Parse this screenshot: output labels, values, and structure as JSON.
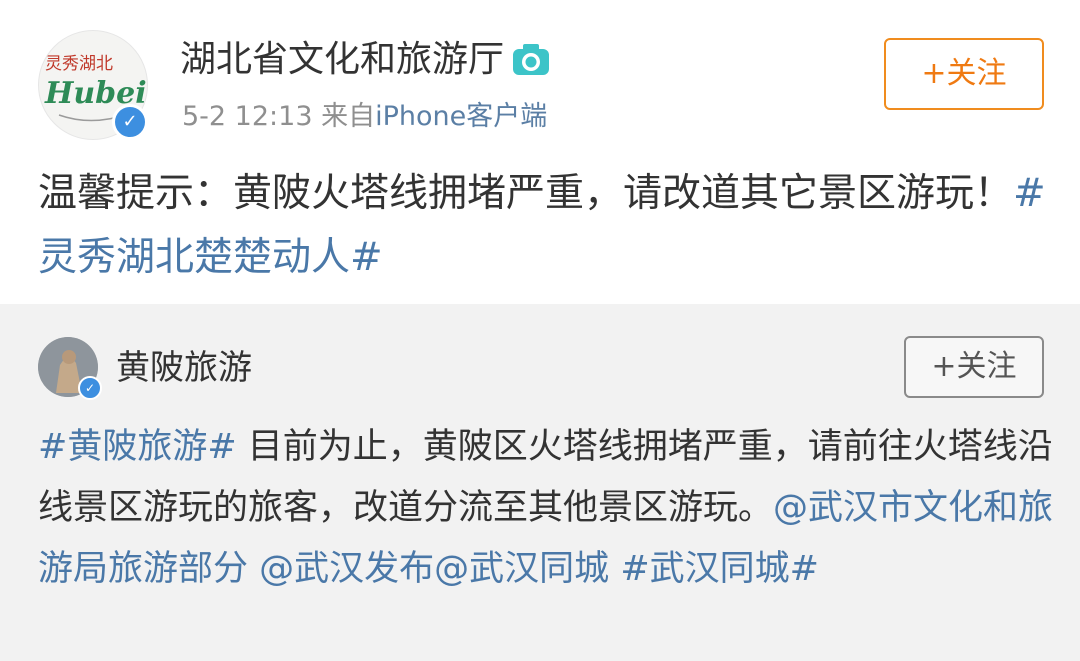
{
  "post": {
    "author": "湖北省文化和旅游厅",
    "avatar_text": "Hubei",
    "avatar_text_cn": "灵秀湖北",
    "timestamp": "5-2 12:13",
    "source_prefix": "来自",
    "source": "iPhone客户端",
    "follow_label": "+关注",
    "text": "温馨提示：黄陂火塔线拥堵严重，请改道其它景区游玩！",
    "hashtag": "#灵秀湖北楚楚动人#",
    "icons": [
      "camera-icon",
      "verified-badge-icon"
    ],
    "colors": {
      "follow": "#ef7a12",
      "link": "#4a78a8",
      "verified": "#3d8fe0"
    }
  },
  "repost": {
    "author": "黄陂旅游",
    "follow_label": "+关注",
    "hashtag1": "#黄陂旅游#",
    "text": " 目前为止，黄陂区火塔线拥堵严重，请前往火塔线沿线景区游玩的旅客，改道分流至其他景区游玩。",
    "mention1": "@武汉市文化和旅游局旅游部分",
    "mention2": " @武汉发布",
    "mention3": "@武汉同城",
    "hashtag2": "#武汉同城#",
    "background": "#f2f2f2"
  }
}
